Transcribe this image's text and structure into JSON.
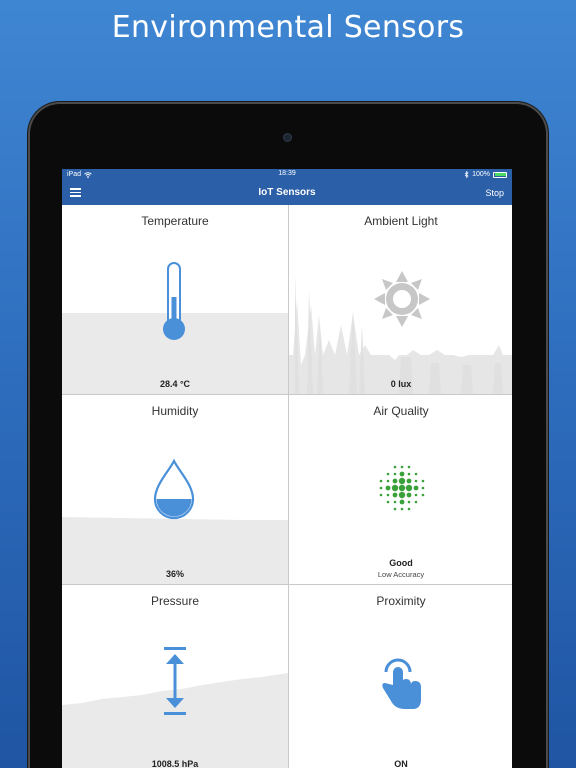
{
  "headline": "Environmental Sensors",
  "status": {
    "carrier": "iPad",
    "time": "18:39",
    "battery": "100%"
  },
  "navbar": {
    "title": "IoT Sensors",
    "stop_label": "Stop"
  },
  "tiles": {
    "temperature": {
      "name": "Temperature",
      "value": "28.4 °C"
    },
    "ambient_light": {
      "name": "Ambient Light",
      "value": "0 lux"
    },
    "humidity": {
      "name": "Humidity",
      "value": "36%"
    },
    "air_quality": {
      "name": "Air Quality",
      "value": "Good",
      "accuracy": "Low Accuracy"
    },
    "pressure": {
      "name": "Pressure",
      "value": "1008.5 hPa"
    },
    "proximity": {
      "name": "Proximity",
      "value": "ON"
    }
  },
  "icons": {
    "menu": "hamburger-icon",
    "wifi": "wifi-icon",
    "bluetooth": "bluetooth-icon",
    "battery": "battery-icon",
    "temperature": "thermometer-icon",
    "ambient_light": "sun-icon",
    "humidity": "water-drop-icon",
    "air_quality": "dot-cluster-icon",
    "pressure": "vertical-arrows-icon",
    "proximity": "tap-finger-icon"
  },
  "colors": {
    "accent": "#4a90d9",
    "navbar": "#2b5fa7",
    "air_good": "#3aa03a",
    "graph": "#e8e8e8"
  }
}
